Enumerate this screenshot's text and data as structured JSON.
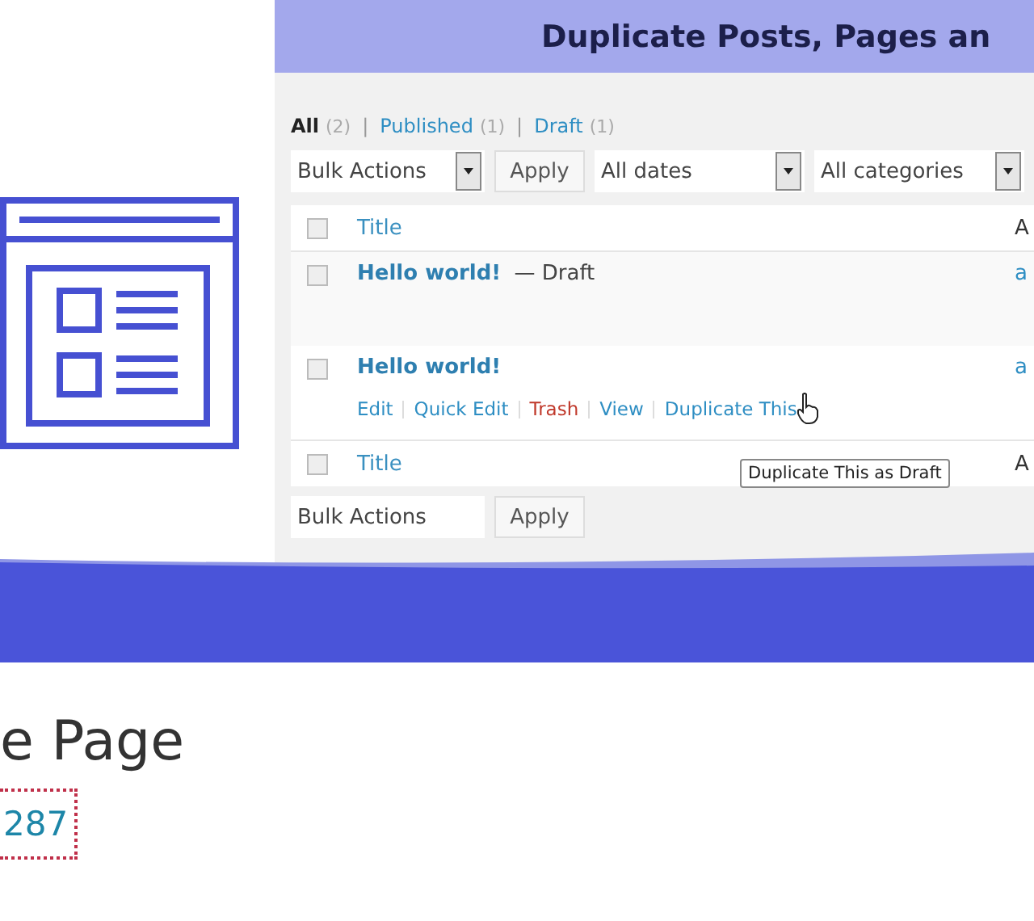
{
  "banner": {
    "heading": "Duplicate Posts, Pages an",
    "filters": [
      {
        "label": "All",
        "count": "(2)",
        "selected": true
      },
      {
        "label": "Published",
        "count": "(1)",
        "selected": false,
        "separator": "|"
      },
      {
        "label": "Draft",
        "count": "(1)",
        "selected": false,
        "separator": "|"
      }
    ],
    "toolbar": {
      "bulk_actions": "Bulk Actions",
      "apply": "Apply",
      "dates": "All dates",
      "categories": "All categories"
    },
    "table": {
      "columns": [
        "Title",
        "A"
      ],
      "header_checked": false,
      "rows": [
        {
          "title": "Hello world!",
          "state": "— Draft",
          "author": "a",
          "checked": false,
          "actions": []
        },
        {
          "title": "Hello world!",
          "author": "a",
          "checked": false,
          "actions": [
            {
              "label": "Edit",
              "kind": "link"
            },
            {
              "label": "Quick Edit",
              "kind": "link"
            },
            {
              "label": "Trash",
              "kind": "danger"
            },
            {
              "label": "View",
              "kind": "link"
            },
            {
              "label": "Duplicate This",
              "kind": "link"
            }
          ]
        }
      ],
      "footer_columns": [
        "Title",
        "A"
      ],
      "footer_checked": false
    },
    "tooltip": "Duplicate This as Draft",
    "bottom_toolbar": {
      "bulk_actions": "Bulk Actions",
      "apply": "Apply"
    }
  },
  "page_title": "e Page",
  "link": "287"
}
